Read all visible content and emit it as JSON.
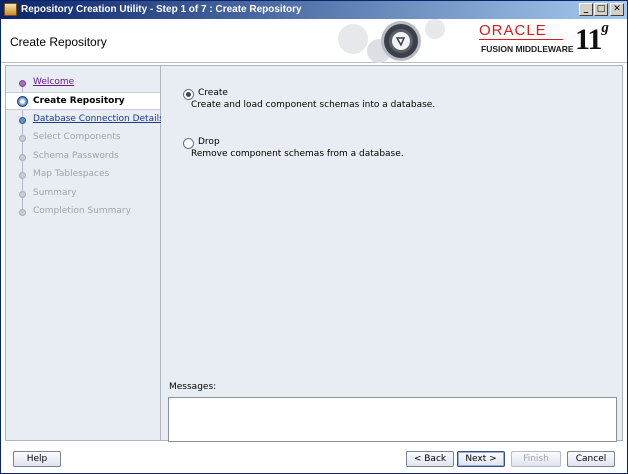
{
  "window": {
    "title": "Repository Creation Utility - Step 1 of 7 : Create Repository",
    "controls": {
      "minimize": "_",
      "maximize": "□",
      "close": "✕"
    }
  },
  "header": {
    "page_title": "Create Repository",
    "logo_oracle": "ORACLE",
    "logo_fusion": "FUSION MIDDLEWARE",
    "version_number": "11",
    "version_letter": "g",
    "brand_color": "#d41e1e"
  },
  "nav": {
    "items": [
      {
        "label": "Welcome",
        "state": "visited"
      },
      {
        "label": "Create Repository",
        "state": "current"
      },
      {
        "label": "Database Connection Details",
        "state": "link"
      },
      {
        "label": "Select Components",
        "state": "disabled"
      },
      {
        "label": "Schema Passwords",
        "state": "disabled"
      },
      {
        "label": "Map Tablespaces",
        "state": "disabled"
      },
      {
        "label": "Summary",
        "state": "disabled"
      },
      {
        "label": "Completion Summary",
        "state": "disabled"
      }
    ]
  },
  "main": {
    "options": [
      {
        "label": "Create",
        "description": "Create and load component schemas into a database.",
        "selected": true
      },
      {
        "label": "Drop",
        "description": "Remove component schemas from a database.",
        "selected": false
      }
    ],
    "messages_label": "Messages:",
    "messages_value": ""
  },
  "buttons": {
    "help": "Help",
    "back": "< Back",
    "next": "Next >",
    "finish": "Finish",
    "cancel": "Cancel"
  }
}
